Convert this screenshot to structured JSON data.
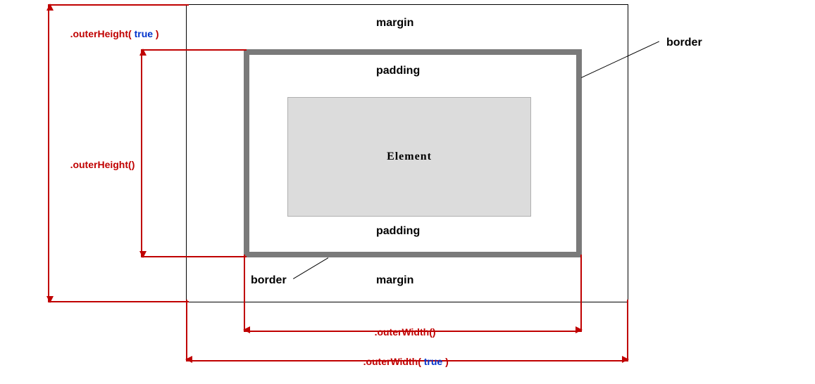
{
  "regions": {
    "margin_top": "margin",
    "margin_bottom": "margin",
    "padding_top": "padding",
    "padding_bottom": "padding",
    "element": "Element"
  },
  "callouts": {
    "border_tr": "border",
    "border_bl": "border"
  },
  "dims": {
    "outerHeightTrue": {
      "method": ".outerHeight",
      "open": "( ",
      "arg": "true",
      "close": " )"
    },
    "outerHeight": {
      "method": ".outerHeight",
      "open": "(",
      "arg": "",
      "close": ")"
    },
    "outerWidth": {
      "method": ".outerWidth",
      "open": "(",
      "arg": "",
      "close": ")"
    },
    "outerWidthTrue": {
      "method": ".outerWidth",
      "open": "( ",
      "arg": "true",
      "close": " )"
    }
  }
}
